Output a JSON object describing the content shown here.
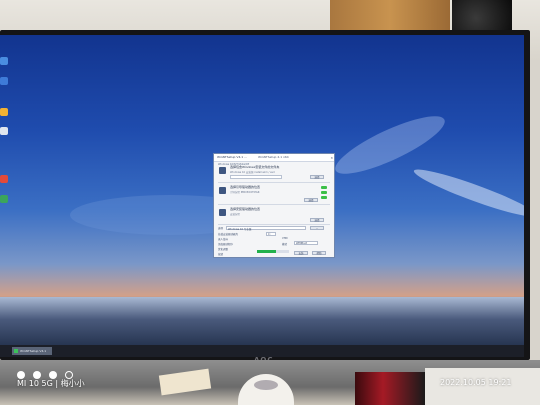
{
  "watermark": {
    "brand": "MI 10 5G",
    "separator": "|",
    "credit": "梅小小",
    "date": "2022.10.05",
    "time": "19:21"
  },
  "monitor": {
    "logo": "AOC"
  },
  "taskbar": {
    "app_button_label": "WinNTSetup V4.1"
  },
  "window": {
    "title": "WinNTSetup V4.1 ...",
    "title_extra": "WinNTSetup 4.1 x64",
    "header_note": "Windows 10/8/7/Vista/XP",
    "sections": [
      {
        "title": "选择包含Windows安装文件的文件夹",
        "desc": "Windows 10 安装源 install.wim / esd",
        "button": "选择",
        "status": ""
      },
      {
        "title": "选择引导驱动器的位置",
        "desc": "引导分区 PBR BOOTMGR",
        "button": "选择",
        "status": "PBR BOOTMGR"
      },
      {
        "title": "选择安装驱动器的位置",
        "desc": "安装分区",
        "button": "选择",
        "status": ""
      }
    ],
    "options": {
      "edition_label": "选项",
      "edition_value": "Windows 10 专业版",
      "mount_label": "挂载安装驱动器为",
      "mount_value": "C:",
      "unattend_label": "无人值守",
      "add_drivers_label": "添加驱动程序",
      "tweaks_label": "优化调整",
      "vhd_label": "VHD",
      "mode_label": "模式",
      "mode_value": "WIMBoot"
    },
    "progress_fraction": 0.6,
    "footer": {
      "status": "就绪",
      "setup_button": "安装",
      "help_button": "帮助"
    }
  },
  "colors": {
    "progress": "#22b14c",
    "sky_top": "#12348f",
    "sunset": "#d2a08a"
  }
}
